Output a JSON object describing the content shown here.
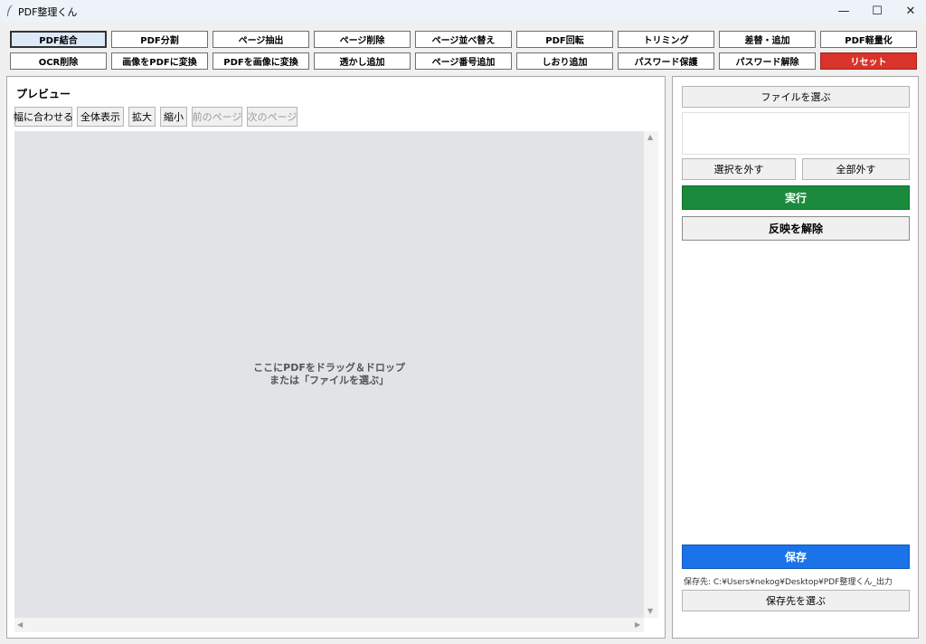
{
  "window": {
    "title": "PDF整理くん",
    "minimize": "—",
    "maximize": "☐",
    "close": "✕"
  },
  "toolbar": {
    "row1": [
      "PDF結合",
      "PDF分割",
      "ページ抽出",
      "ページ削除",
      "ページ並べ替え",
      "PDF回転",
      "トリミング",
      "差替・追加",
      "PDF軽量化"
    ],
    "row2": [
      "OCR削除",
      "画像をPDFに変換",
      "PDFを画像に変換",
      "透かし追加",
      "ページ番号追加",
      "しおり追加",
      "パスワード保護",
      "パスワード解除",
      "リセット"
    ],
    "active": "PDF結合",
    "danger_color": "#d9342b"
  },
  "preview": {
    "title": "プレビュー",
    "buttons": {
      "fit_width": "幅に合わせる",
      "fit_all": "全体表示",
      "zoom_in": "拡大",
      "zoom_out": "縮小",
      "prev_page": "前のページ",
      "next_page": "次のページ"
    },
    "drop_hint_line1": "ここにPDFをドラッグ＆ドロップ",
    "drop_hint_line2": "または「ファイルを選ぶ」"
  },
  "side": {
    "choose_file": "ファイルを選ぶ",
    "deselect": "選択を外す",
    "deselect_all": "全部外す",
    "run": "実行",
    "undo": "反映を解除",
    "save": "保存",
    "save_path": "保存先: C:¥Users¥nekog¥Desktop¥PDF整理くん_出力",
    "choose_dest": "保存先を選ぶ",
    "run_color": "#1b8a3d",
    "save_color": "#1a73e8"
  }
}
